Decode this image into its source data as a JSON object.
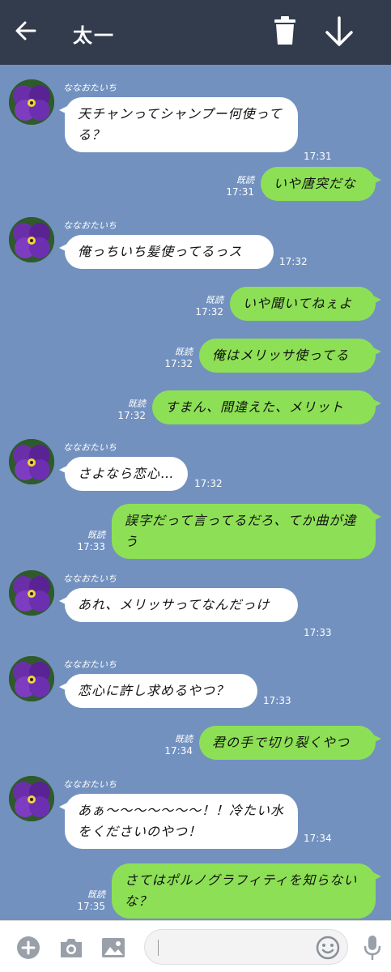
{
  "header": {
    "title": "太一",
    "back_icon": "arrow-left-icon",
    "trash_icon": "trash-icon",
    "down_icon": "arrow-down-icon"
  },
  "colors": {
    "header_bg": "#333c4d",
    "chat_bg": "#7291bf",
    "outgoing_bubble": "#8de055",
    "incoming_bubble": "#ffffff"
  },
  "messages": [
    {
      "dir": "in",
      "sender": "ななおたいち",
      "text": "天チャンってシャンプー何使ってる？",
      "time": "17:31"
    },
    {
      "dir": "out",
      "read": "既読",
      "text": "いや唐突だな",
      "time": "17:31"
    },
    {
      "dir": "in",
      "sender": "ななおたいち",
      "text": "俺っちいち髪使ってるっス",
      "time": "17:32"
    },
    {
      "dir": "out",
      "read": "既読",
      "text": "いや聞いてねぇよ",
      "time": "17:32"
    },
    {
      "dir": "out",
      "read": "既読",
      "text": "俺はメリッサ使ってる",
      "time": "17:32"
    },
    {
      "dir": "out",
      "read": "既読",
      "text": "すまん、間違えた、メリット",
      "time": "17:32"
    },
    {
      "dir": "in",
      "sender": "ななおたいち",
      "text": "さよなら恋心…",
      "time": "17:32"
    },
    {
      "dir": "out",
      "read": "既読",
      "text": "誤字だって言ってるだろ、てか曲が違う",
      "time": "17:33"
    },
    {
      "dir": "in",
      "sender": "ななおたいち",
      "text": "あれ、メリッサってなんだっけ",
      "time": "17:33"
    },
    {
      "dir": "in",
      "sender": "ななおたいち",
      "text": "恋心に許し求めるやつ？",
      "time": "17:33"
    },
    {
      "dir": "out",
      "read": "既読",
      "text": "君の手で切り裂くやつ",
      "time": "17:34"
    },
    {
      "dir": "in",
      "sender": "ななおたいち",
      "text": "あぁ〜〜〜〜〜〜〜！！冷たい水をくださいのやつ！",
      "time": "17:34"
    },
    {
      "dir": "out",
      "read": "既読",
      "text": "さてはポルノグラフィティを知らないな？",
      "time": "17:35"
    }
  ],
  "footer": {
    "icons": [
      "plus-icon",
      "camera-icon",
      "image-icon",
      "smile-icon",
      "mic-icon"
    ],
    "input_value": "",
    "input_placeholder": ""
  }
}
